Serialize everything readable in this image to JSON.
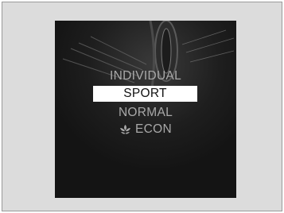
{
  "modes": [
    {
      "label": "INDIVIDUAL",
      "selected": false
    },
    {
      "label": "SPORT",
      "selected": true
    },
    {
      "label": "NORMAL",
      "selected": false
    },
    {
      "label": "ECON",
      "selected": false,
      "icon": "leaf-icon"
    }
  ],
  "colors": {
    "screen_background": "#1a1a1a",
    "item_text": "#a9a9a9",
    "selected_background": "#ffffff",
    "selected_text": "#111111"
  }
}
